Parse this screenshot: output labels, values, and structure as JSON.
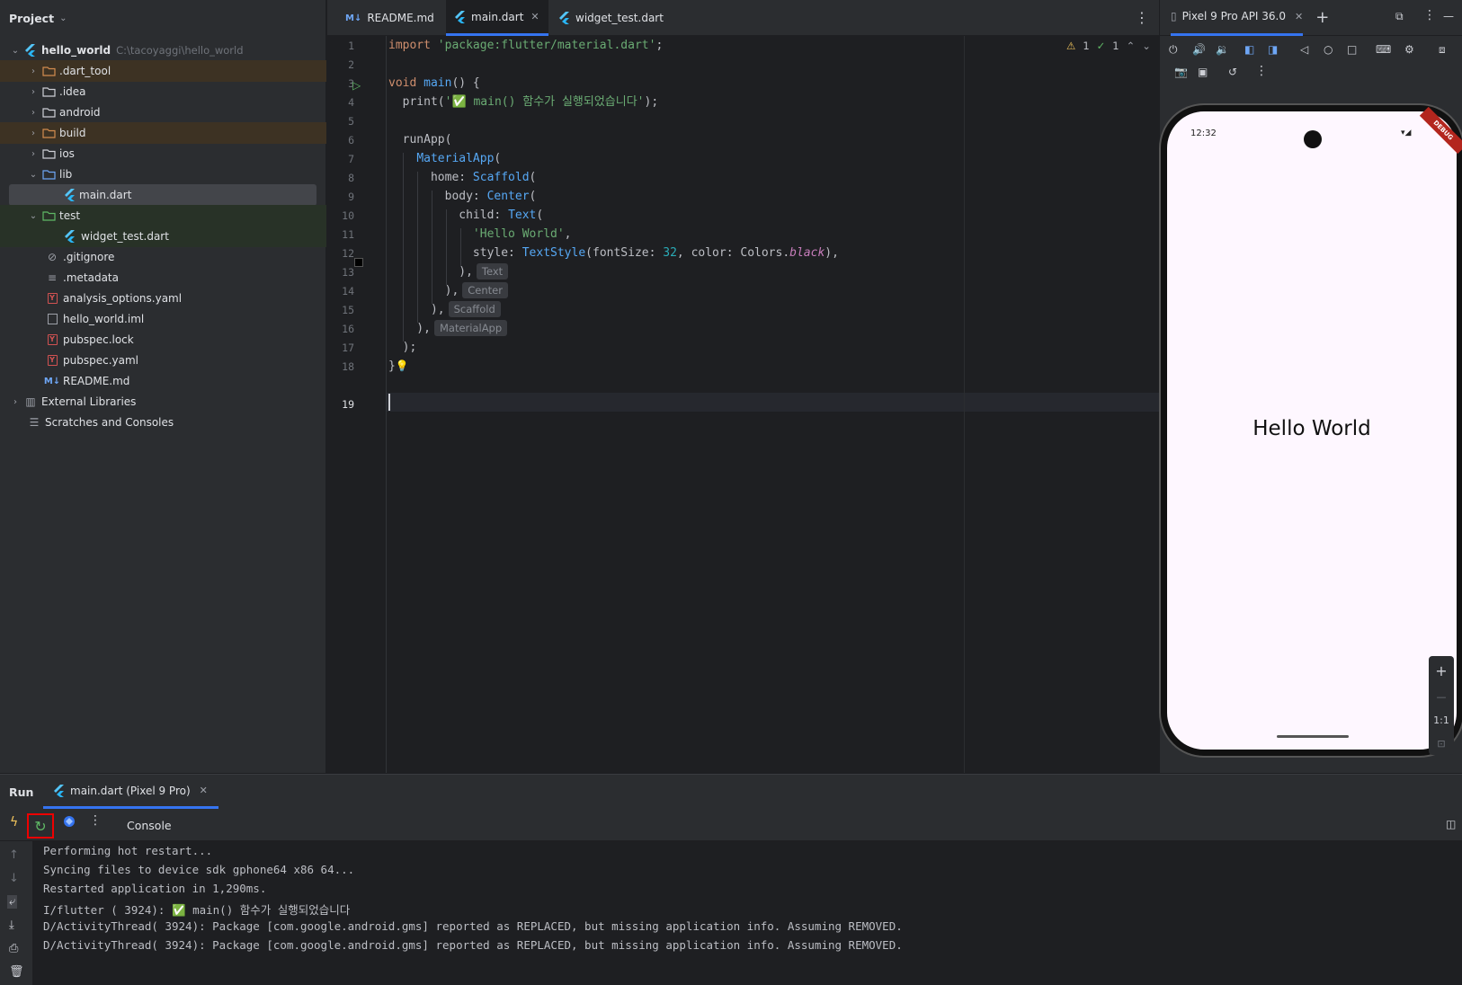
{
  "project": {
    "title": "Project",
    "root_name": "hello_world",
    "root_path": "C:\\tacoyaggi\\hello_world",
    "items": [
      {
        "label": ".dart_tool"
      },
      {
        "label": ".idea"
      },
      {
        "label": "android"
      },
      {
        "label": "build"
      },
      {
        "label": "ios"
      },
      {
        "label": "lib"
      },
      {
        "label": "main.dart"
      },
      {
        "label": "test"
      },
      {
        "label": "widget_test.dart"
      },
      {
        "label": ".gitignore"
      },
      {
        "label": ".metadata"
      },
      {
        "label": "analysis_options.yaml"
      },
      {
        "label": "hello_world.iml"
      },
      {
        "label": "pubspec.lock"
      },
      {
        "label": "pubspec.yaml"
      },
      {
        "label": "README.md"
      },
      {
        "label": "External Libraries"
      },
      {
        "label": "Scratches and Consoles"
      }
    ]
  },
  "editor": {
    "tabs": [
      {
        "label": "README.md"
      },
      {
        "label": "main.dart"
      },
      {
        "label": "widget_test.dart"
      }
    ],
    "inspection": {
      "warnings": "1",
      "checks": "1"
    },
    "line_numbers": [
      "1",
      "2",
      "3",
      "4",
      "5",
      "6",
      "7",
      "8",
      "9",
      "10",
      "11",
      "12",
      "13",
      "14",
      "15",
      "16",
      "17",
      "18",
      "19"
    ],
    "code": {
      "l1_kw": "import",
      "l1_str": "'package:flutter/material.dart'",
      "l1_end": ";",
      "l3_kw": "void",
      "l3_fn": "main",
      "l3_end": "() {",
      "l4_a": "  print(",
      "l4_str": "'✅ main() 함수가 실행되었습니다'",
      "l4_end": ");",
      "l6": "  runApp(",
      "l7_cls": "MaterialApp",
      "l7_end": "(",
      "l8_a": "      home: ",
      "l8_cls": "Scaffold",
      "l8_end": "(",
      "l9_a": "        body: ",
      "l9_cls": "Center",
      "l9_end": "(",
      "l10_a": "          child: ",
      "l10_cls": "Text",
      "l10_end": "(",
      "l11_str": "'Hello World'",
      "l11_end": ",",
      "l12_a": "            style: ",
      "l12_cls": "TextStyle",
      "l12_b": "(fontSize: ",
      "l12_num": "32",
      "l12_c": ", color: Colors.",
      "l12_itl": "black",
      "l12_end": "),",
      "l13": "          ),",
      "l13_hint": "Text",
      "l14": "        ),",
      "l14_hint": "Center",
      "l15": "      ),",
      "l15_hint": "Scaffold",
      "l16": "    ),",
      "l16_hint": "MaterialApp",
      "l17": "  );",
      "l18": "}"
    }
  },
  "emulator": {
    "device": "Pixel 9 Pro API 36.0",
    "status_time": "12:32",
    "debug_label": "DEBUG",
    "app_text": "Hello World",
    "zoom_label": "1:1"
  },
  "run": {
    "title": "Run",
    "tab_label": "main.dart (Pixel 9 Pro)",
    "console_label": "Console",
    "lines": [
      "Performing hot restart...",
      "Syncing files to device sdk gphone64 x86 64...",
      "Restarted application in 1,290ms.",
      "I/flutter ( 3924): ✅ main() 함수가 실행되었습니다",
      "D/ActivityThread( 3924): Package [com.google.android.gms] reported as REPLACED, but missing application info. Assuming REMOVED.",
      "D/ActivityThread( 3924): Package [com.google.android.gms] reported as REPLACED, but missing application info. Assuming REMOVED."
    ]
  }
}
